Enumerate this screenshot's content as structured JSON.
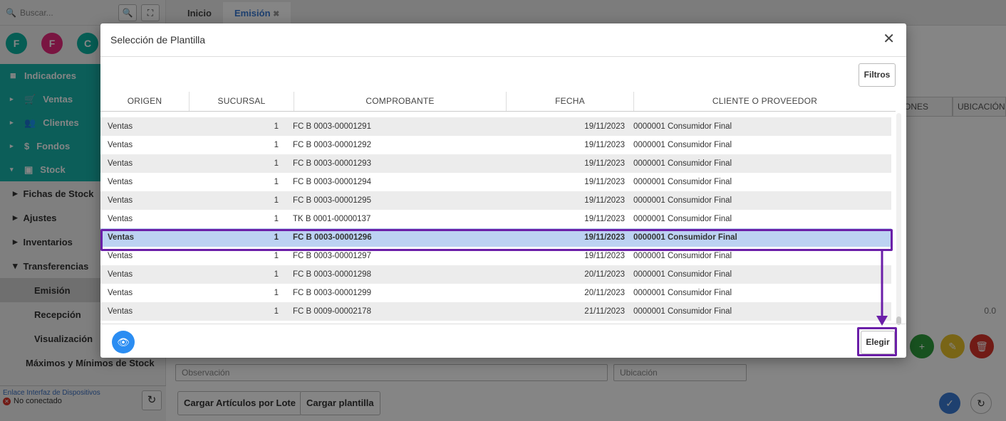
{
  "sidebar": {
    "search_placeholder": "Buscar...",
    "avatars": [
      "F",
      "F",
      "C"
    ],
    "avatar_colors": [
      "#0db3a2",
      "#e8297e",
      "#0db3a2"
    ],
    "menu": [
      {
        "label": "Indicadores",
        "arrow": ""
      },
      {
        "label": "Ventas",
        "arrow": "▸"
      },
      {
        "label": "Clientes",
        "arrow": "▸"
      },
      {
        "label": "Fondos",
        "arrow": "▸"
      },
      {
        "label": "Stock",
        "arrow": "▾"
      }
    ],
    "submenu": [
      {
        "label": "Fichas de Stock",
        "arrow": "▸"
      },
      {
        "label": "Ajustes",
        "arrow": "▸"
      },
      {
        "label": "Inventarios",
        "arrow": "▸"
      },
      {
        "label": "Transferencias",
        "arrow": "▾"
      },
      {
        "label": "Emisión"
      },
      {
        "label": "Recepción"
      },
      {
        "label": "Visualización"
      },
      {
        "label": "Máximos y Mínimos de Stock"
      }
    ],
    "footer_link": "Enlace Interfaz de Dispositivos",
    "status": "No conectado"
  },
  "tabs": [
    {
      "label": "Inicio"
    },
    {
      "label": "Emisión"
    }
  ],
  "background": {
    "col_headers": [
      "ONES",
      "UBICACIÓN"
    ],
    "zero_value": "0.0",
    "observacion_placeholder": "Observación",
    "ubicacion_placeholder": "Ubicación",
    "btn_lote": "Cargar Artículos por Lote",
    "btn_plantilla": "Cargar plantilla"
  },
  "modal": {
    "title": "Selección de Plantilla",
    "filter_label": "Filtros",
    "choose_label": "Elegir",
    "columns": [
      "ORIGEN",
      "SUCURSAL",
      "COMPROBANTE",
      "FECHA",
      "CLIENTE O PROVEEDOR"
    ],
    "rows": [
      {
        "origen": "Ventas",
        "sucursal": "1",
        "comprobante": "FC B 0003-00001291",
        "fecha": "19/11/2023",
        "cliente": "0000001 Consumidor Final"
      },
      {
        "origen": "Ventas",
        "sucursal": "1",
        "comprobante": "FC B 0003-00001292",
        "fecha": "19/11/2023",
        "cliente": "0000001 Consumidor Final"
      },
      {
        "origen": "Ventas",
        "sucursal": "1",
        "comprobante": "FC B 0003-00001293",
        "fecha": "19/11/2023",
        "cliente": "0000001 Consumidor Final"
      },
      {
        "origen": "Ventas",
        "sucursal": "1",
        "comprobante": "FC B 0003-00001294",
        "fecha": "19/11/2023",
        "cliente": "0000001 Consumidor Final"
      },
      {
        "origen": "Ventas",
        "sucursal": "1",
        "comprobante": "FC B 0003-00001295",
        "fecha": "19/11/2023",
        "cliente": "0000001 Consumidor Final"
      },
      {
        "origen": "Ventas",
        "sucursal": "1",
        "comprobante": "TK B 0001-00000137",
        "fecha": "19/11/2023",
        "cliente": "0000001 Consumidor Final"
      },
      {
        "origen": "Ventas",
        "sucursal": "1",
        "comprobante": "FC B 0003-00001296",
        "fecha": "19/11/2023",
        "cliente": "0000001 Consumidor Final",
        "selected": true
      },
      {
        "origen": "Ventas",
        "sucursal": "1",
        "comprobante": "FC B 0003-00001297",
        "fecha": "19/11/2023",
        "cliente": "0000001 Consumidor Final"
      },
      {
        "origen": "Ventas",
        "sucursal": "1",
        "comprobante": "FC B 0003-00001298",
        "fecha": "20/11/2023",
        "cliente": "0000001 Consumidor Final"
      },
      {
        "origen": "Ventas",
        "sucursal": "1",
        "comprobante": "FC B 0003-00001299",
        "fecha": "20/11/2023",
        "cliente": "0000001 Consumidor Final"
      },
      {
        "origen": "Ventas",
        "sucursal": "1",
        "comprobante": "FC B 0009-00002178",
        "fecha": "21/11/2023",
        "cliente": "0000001 Consumidor Final"
      }
    ]
  },
  "colors": {
    "accent": "#3a7bd5",
    "teal": "#17b5ab",
    "selected_row": "#bcd2f2",
    "annotation": "#6b1fa8"
  }
}
